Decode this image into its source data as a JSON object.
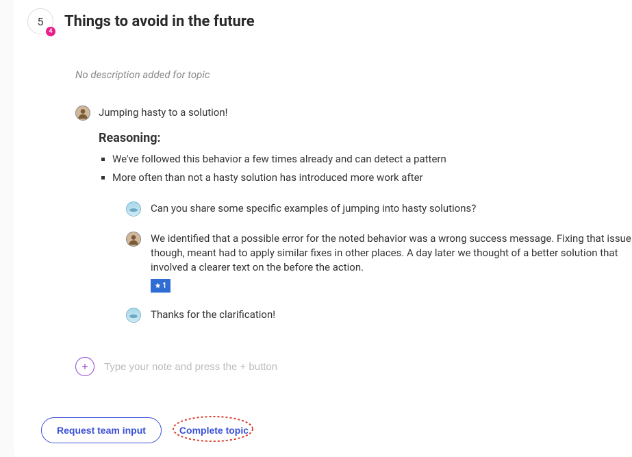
{
  "topic": {
    "number": "5",
    "badge": "4",
    "title": "Things to avoid in the future",
    "description": "No description added for topic"
  },
  "main_note": {
    "lead": "Jumping hasty to a solution!",
    "reasoning_title": "Reasoning:",
    "reasons": [
      "We've followed this behavior a few times already and can detect a pattern",
      "More often than not a hasty solution has introduced more work after"
    ]
  },
  "replies": [
    {
      "avatar": "blue",
      "text": "Can you share some specific examples of jumping into hasty solutions?"
    },
    {
      "avatar": "tan",
      "text": "We identified that a possible error for the noted behavior was a wrong success message. Fixing that issue though, meant had to apply similar fixes in other places. A day later we thought of a better solution that involved a clearer text on the before the action.",
      "star": "1"
    },
    {
      "avatar": "blue",
      "text": "Thanks for the clarification!"
    }
  ],
  "add_note": {
    "placeholder": "Type your note and press the + button"
  },
  "actions": {
    "request_label": "Request team input",
    "complete_label": "Complete topic"
  }
}
